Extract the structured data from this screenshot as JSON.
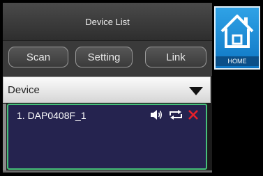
{
  "titlebar": {
    "title": "Device List"
  },
  "toolbar": {
    "scan_label": "Scan",
    "setting_label": "Setting",
    "link_label": "Link"
  },
  "dropdown": {
    "selected": "Device"
  },
  "devices": [
    {
      "name": "1. DAP0408F_1",
      "icons": [
        "speaker-icon",
        "repeat-icon",
        "close-icon"
      ]
    }
  ],
  "home": {
    "label": "HOME"
  },
  "colors": {
    "background": "#000000",
    "accent_blue": "#0e76c4",
    "device_bg": "#25234f",
    "device_border": "#46c07a",
    "delete_red": "#e8202a"
  }
}
